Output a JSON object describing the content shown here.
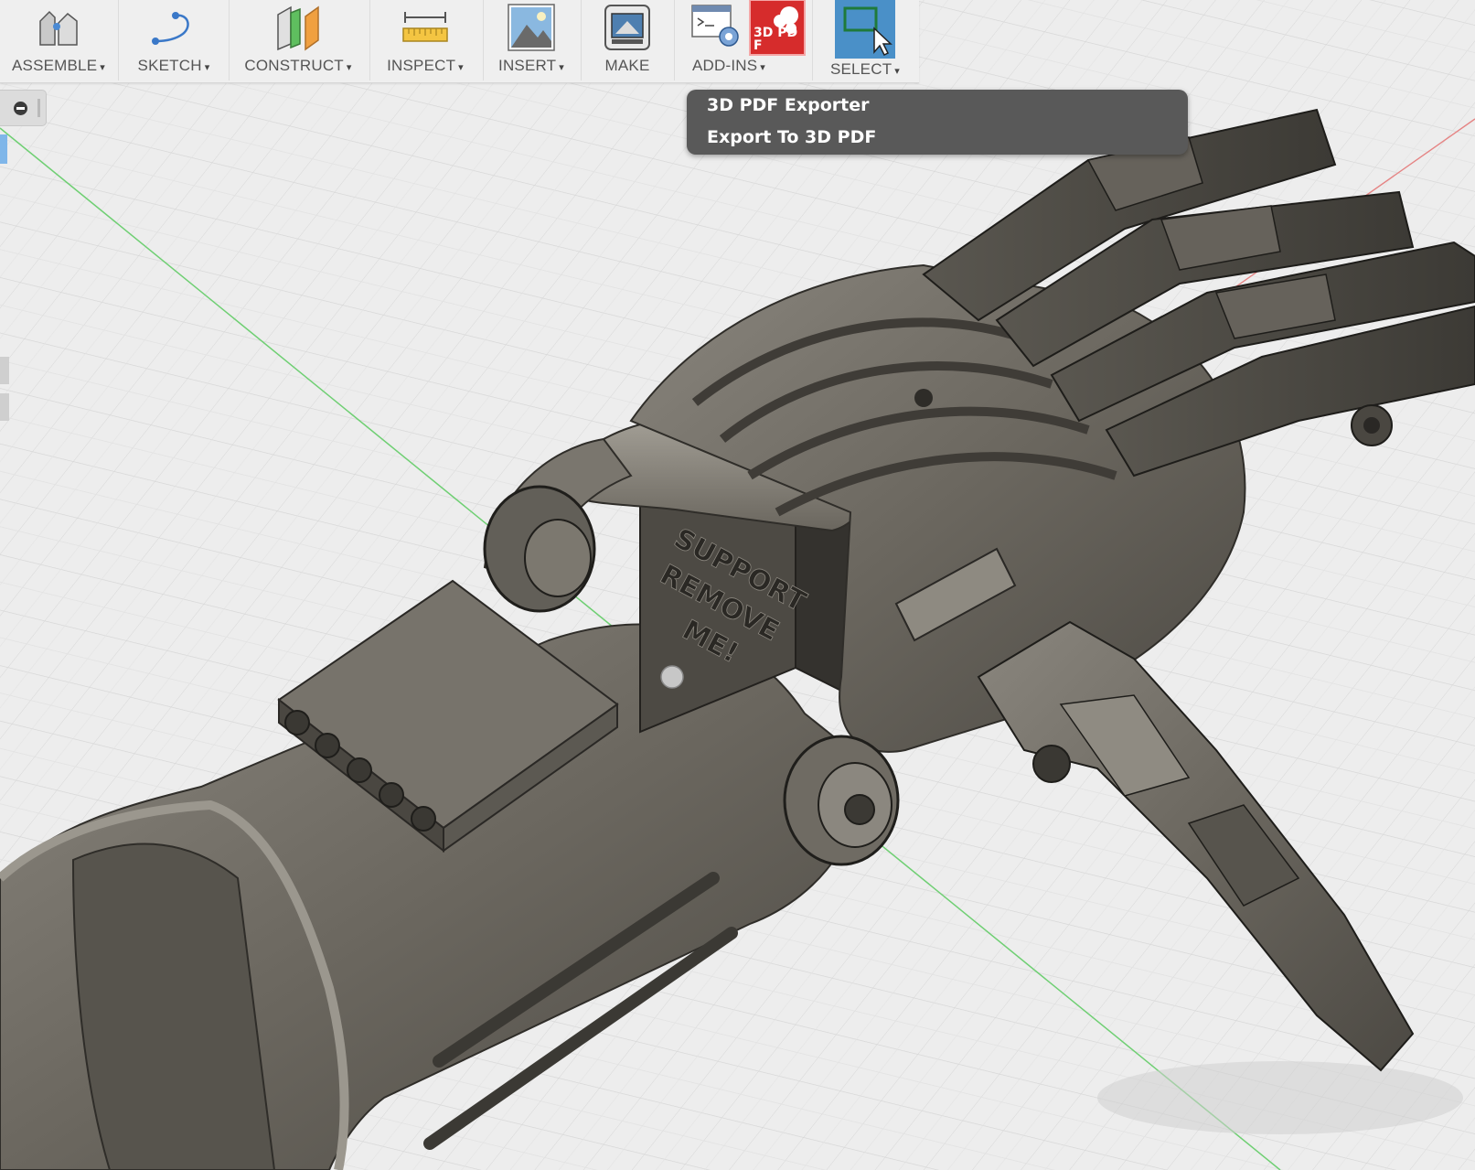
{
  "toolbar": {
    "items": [
      {
        "label": "ASSEMBLE",
        "icon": "assemble-icon",
        "has_menu": true
      },
      {
        "label": "SKETCH",
        "icon": "sketch-icon",
        "has_menu": true
      },
      {
        "label": "CONSTRUCT",
        "icon": "construct-icon",
        "has_menu": true
      },
      {
        "label": "INSPECT",
        "icon": "inspect-icon",
        "has_menu": true
      },
      {
        "label": "INSERT",
        "icon": "insert-image-icon",
        "has_menu": true
      },
      {
        "label": "MAKE",
        "icon": "make-3d-print-icon",
        "has_menu": false
      },
      {
        "label": "ADD-INS",
        "icon": "add-ins-script-icon",
        "has_menu": true
      },
      {
        "label": "SELECT",
        "icon": "select-window-icon",
        "has_menu": true
      }
    ],
    "caret": "▾",
    "pdf_badge_text": "3D PDF",
    "active_item": "SELECT"
  },
  "addins_dropdown": {
    "items": [
      {
        "label": "3D PDF Exporter"
      },
      {
        "label": "Export To 3D PDF"
      }
    ]
  },
  "model": {
    "engraved_text": [
      "SUPPORT",
      "REMOVE",
      "ME!"
    ]
  },
  "colors": {
    "toolbar_bg": "#efefef",
    "menu_bg": "#595959",
    "select_active": "#4a90c8",
    "pdf_red": "#d62c2c",
    "model_metal": "#6d6961",
    "grid_line": "#d4d4d4",
    "axis_green": "#66c96a",
    "axis_red": "#e27a7a"
  }
}
